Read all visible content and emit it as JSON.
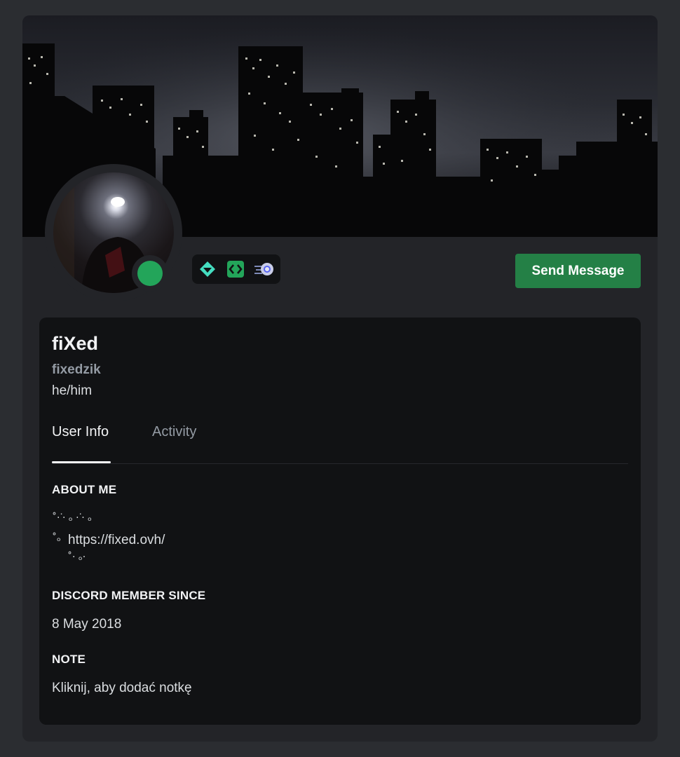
{
  "profile": {
    "display_name": "fiXed",
    "username": "fixedzik",
    "pronouns": "he/him",
    "status_color": "#23a55a",
    "badges": [
      "hypesquad-balance-icon",
      "active-developer-icon",
      "quest-orb-icon"
    ]
  },
  "actions": {
    "send_message_label": "Send Message"
  },
  "tabs": [
    {
      "label": "User Info",
      "active": true
    },
    {
      "label": "Activity",
      "active": false
    }
  ],
  "about": {
    "title": "ABOUT ME",
    "deco_line_1": "˚·ᐝ· ₒ ·ᐝ· ₒ",
    "deco_line_2": "˚ₒ",
    "link": "https://fixed.ovh/",
    "deco_line_3": "˚· ₒ·"
  },
  "member_since": {
    "title": "DISCORD MEMBER SINCE",
    "date": "8 May 2018"
  },
  "note": {
    "title": "NOTE",
    "placeholder": "Kliknij, aby dodać notkę"
  },
  "colors": {
    "accent_button": "#248046",
    "panel_bg": "#111214",
    "card_bg": "#232428",
    "page_bg": "#2b2d31"
  }
}
